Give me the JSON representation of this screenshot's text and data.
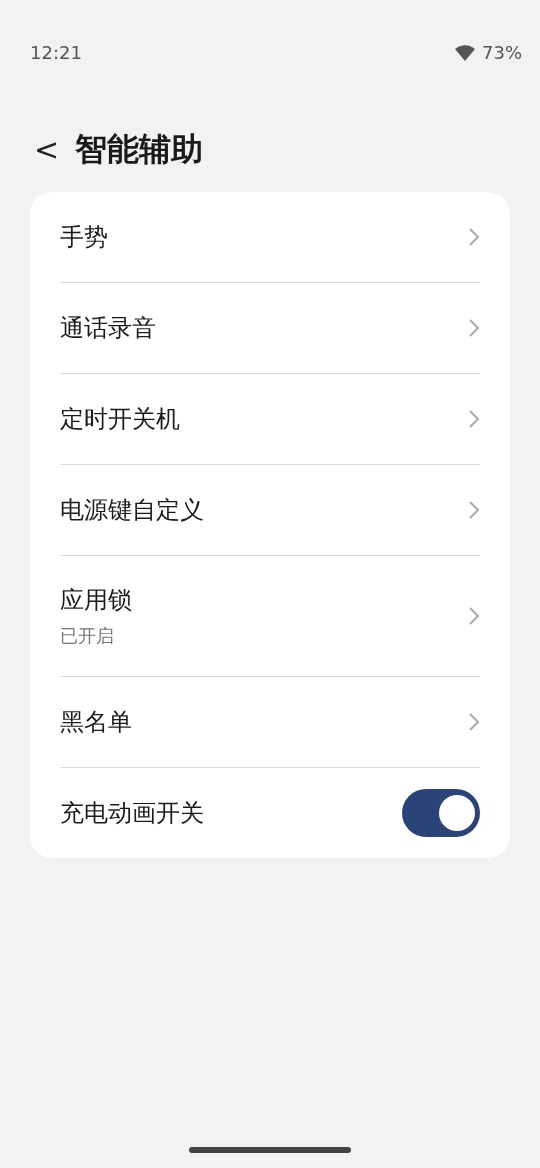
{
  "status_bar": {
    "time": "12:21",
    "battery": "73%"
  },
  "header": {
    "back": "<",
    "title": "智能辅助"
  },
  "items": [
    {
      "kind": "link",
      "label": "手势"
    },
    {
      "kind": "link",
      "label": "通话录音"
    },
    {
      "kind": "link",
      "label": "定时开关机"
    },
    {
      "kind": "link",
      "label": "电源键自定义"
    },
    {
      "kind": "link",
      "label": "应用锁",
      "subtitle": "已开启"
    },
    {
      "kind": "link",
      "label": "黑名单"
    },
    {
      "kind": "toggle",
      "label": "充电动画开关",
      "on": true
    }
  ]
}
